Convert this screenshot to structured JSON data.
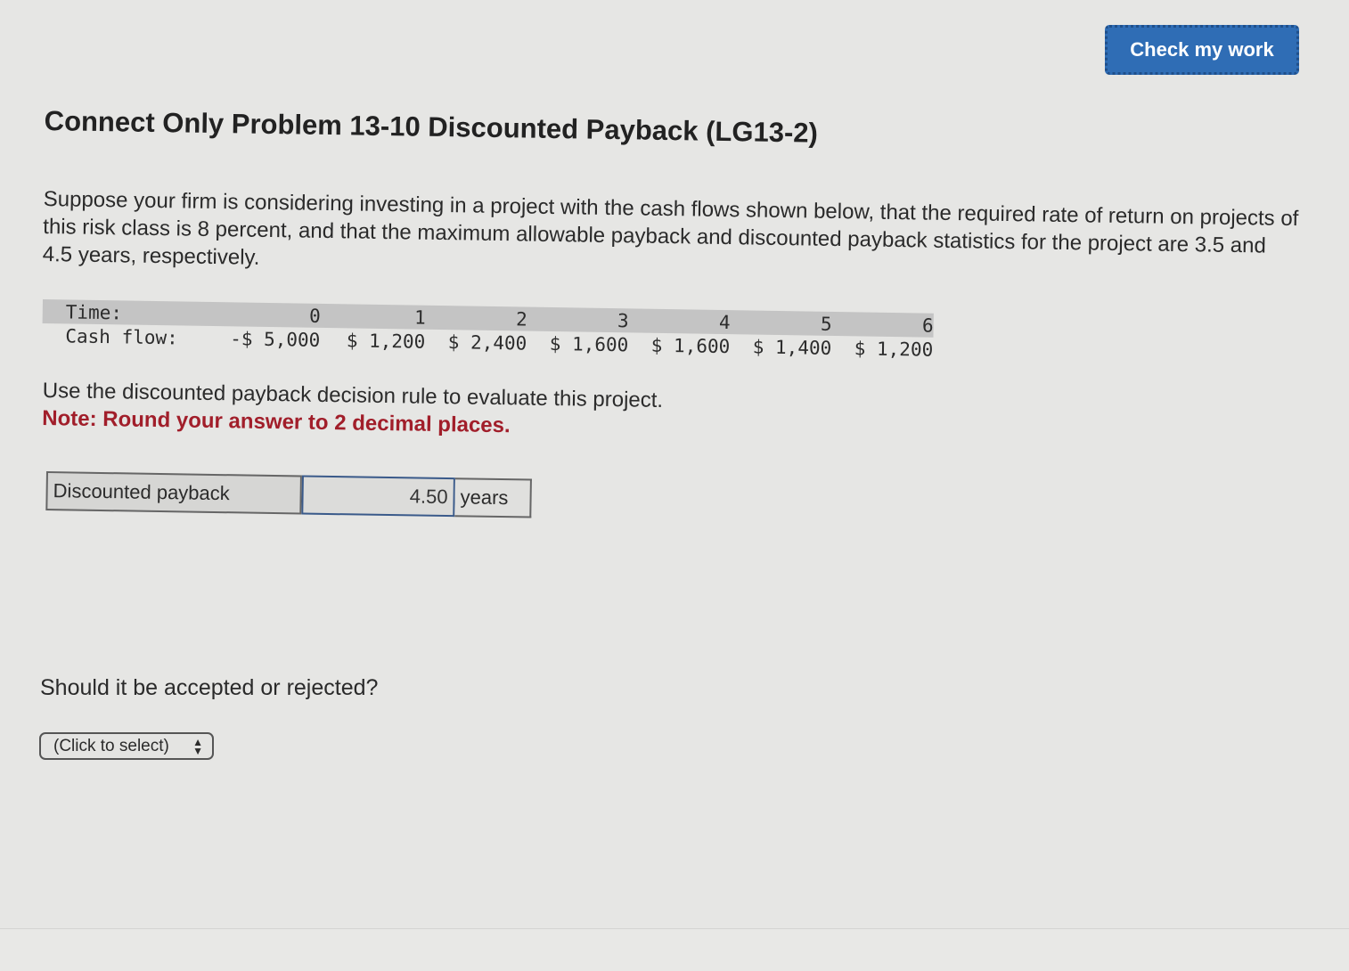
{
  "toolbar": {
    "check_label": "Check my work"
  },
  "problem": {
    "title": "Connect Only Problem 13-10 Discounted Payback (LG13-2)",
    "question": "Suppose your firm is considering investing in a project with the cash flows shown below, that the required rate of return on projects of this risk class is 8 percent, and that the maximum allowable payback and discounted payback statistics for the project are 3.5 and 4.5 years, respectively."
  },
  "cashflow": {
    "time_label": "Time:",
    "cash_label": "Cash flow:",
    "times": [
      "0",
      "1",
      "2",
      "3",
      "4",
      "5",
      "6"
    ],
    "flows": [
      "-$ 5,000",
      "$ 1,200",
      "$ 2,400",
      "$ 1,600",
      "$ 1,600",
      "$ 1,400",
      "$ 1,200"
    ]
  },
  "instruction": {
    "text": "Use the discounted payback decision rule to evaluate this project.",
    "note": "Note: Round your answer to 2 decimal places."
  },
  "answer": {
    "label": "Discounted payback",
    "value": "4.50",
    "unit": "years"
  },
  "decision": {
    "question": "Should it be accepted or rejected?",
    "select_value": "(Click to select)"
  }
}
